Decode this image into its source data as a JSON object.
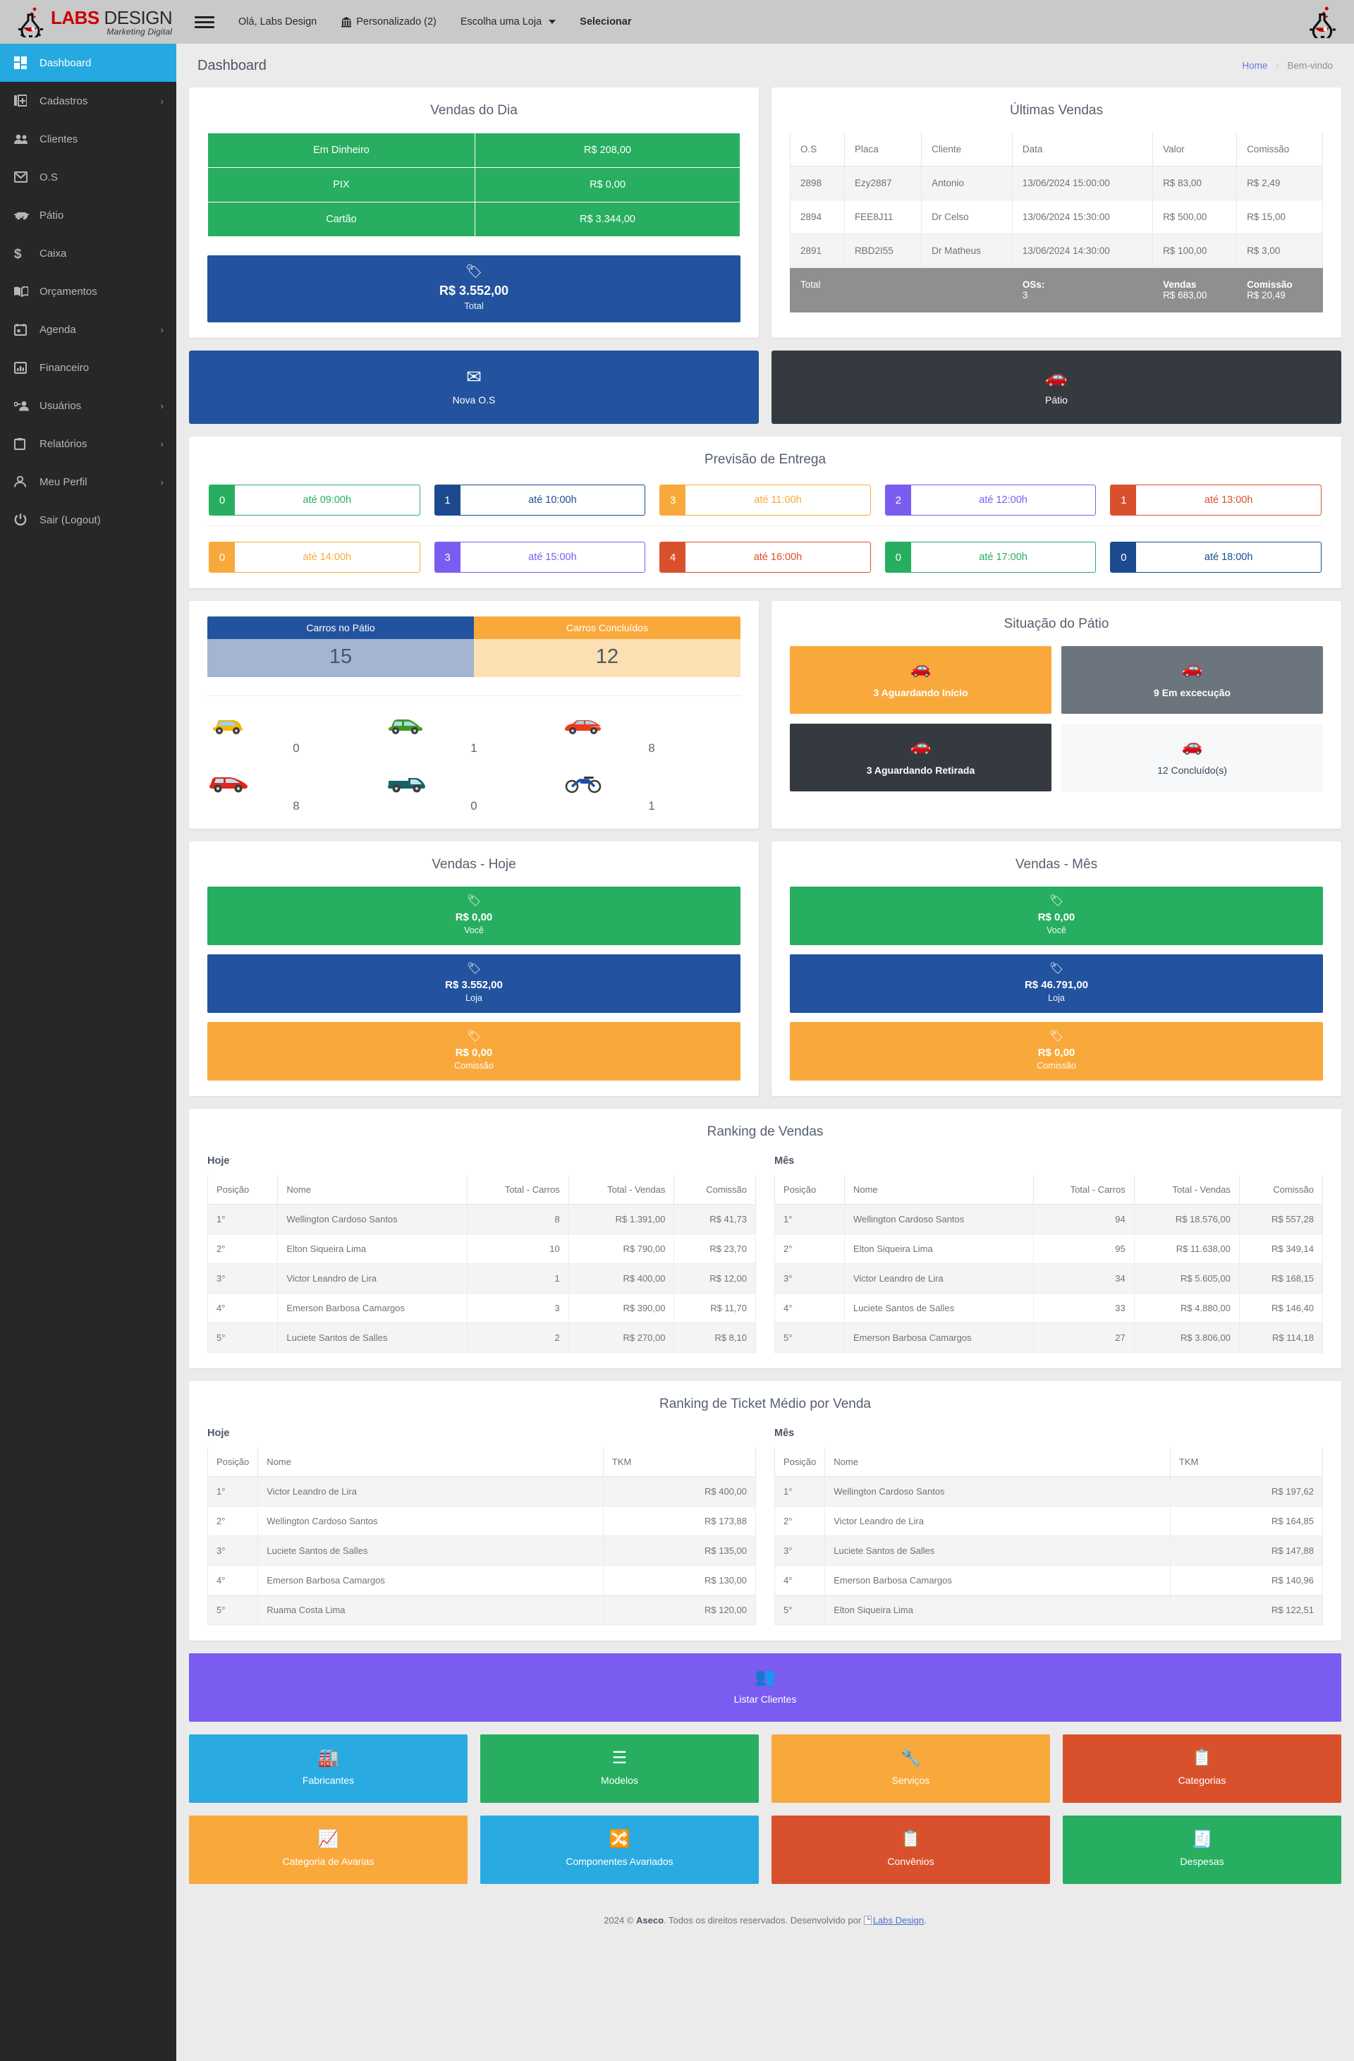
{
  "brand": {
    "line1_bold": "LABS",
    "line1_rest": " DESIGN",
    "line2": "Marketing Digital",
    "logo_icon": "flask-icon"
  },
  "topnav": {
    "menu_icon": "hamburger-icon",
    "greeting": "Olá, Labs Design",
    "custom": "Personalizado (2)",
    "store_select": "Escolha uma Loja",
    "select_button": "Selecionar",
    "avatar_icon": "flask-avatar-icon"
  },
  "sidebar": {
    "items": [
      {
        "label": "Dashboard",
        "icon": "dashboard-grid-icon",
        "active": true,
        "arrow": ""
      },
      {
        "label": "Cadastros",
        "icon": "copy-plus-icon",
        "active": false,
        "arrow": "›"
      },
      {
        "label": "Clientes",
        "icon": "users-icon",
        "active": false,
        "arrow": ""
      },
      {
        "label": "O.S",
        "icon": "envelope-icon",
        "active": false,
        "arrow": ""
      },
      {
        "label": "Pátio",
        "icon": "car-icon",
        "active": false,
        "arrow": ""
      },
      {
        "label": "Caixa",
        "icon": "dollar-icon",
        "active": false,
        "arrow": ""
      },
      {
        "label": "Orçamentos",
        "icon": "book-icon",
        "active": false,
        "arrow": ""
      },
      {
        "label": "Agenda",
        "icon": "calendar-icon",
        "active": false,
        "arrow": "›"
      },
      {
        "label": "Financeiro",
        "icon": "bar-chart-icon",
        "active": false,
        "arrow": ""
      },
      {
        "label": "Usuários",
        "icon": "user-key-icon",
        "active": false,
        "arrow": "›"
      },
      {
        "label": "Relatórios",
        "icon": "clipboard-icon",
        "active": false,
        "arrow": "›"
      },
      {
        "label": "Meu Perfil",
        "icon": "person-icon",
        "active": false,
        "arrow": "›"
      },
      {
        "label": "Sair (Logout)",
        "icon": "power-icon",
        "active": false,
        "arrow": ""
      }
    ]
  },
  "page": {
    "title": "Dashboard",
    "breadcrumb_home": "Home",
    "breadcrumb_sep": "›",
    "breadcrumb_current": "Bem-vindo"
  },
  "vendas_dia": {
    "title": "Vendas do Dia",
    "rows": [
      {
        "label": "Em Dinheiro",
        "value": "R$ 208,00"
      },
      {
        "label": "PIX",
        "value": "R$ 0,00"
      },
      {
        "label": "Cartão",
        "value": "R$ 3.344,00"
      }
    ],
    "total": {
      "icon": "tag-icon",
      "amount": "R$ 3.552,00",
      "label": "Total"
    }
  },
  "ultimas_vendas": {
    "title": "Últimas Vendas",
    "columns": [
      "O.S",
      "Placa",
      "Cliente",
      "Data",
      "Valor",
      "Comissão"
    ],
    "rows": [
      [
        "2898",
        "Ezy2887",
        "Antonio",
        "13/06/2024 15:00:00",
        "R$ 83,00",
        "R$ 2,49"
      ],
      [
        "2894",
        "FEE8J11",
        "Dr Celso",
        "13/06/2024 15:30:00",
        "R$ 500,00",
        "R$ 15,00"
      ],
      [
        "2891",
        "RBD2I55",
        "Dr Matheus",
        "13/06/2024 14:30:00",
        "R$ 100,00",
        "R$ 3,00"
      ]
    ],
    "total_row": {
      "label": "Total",
      "os_label": "OSs:",
      "os_value": "3",
      "vendas_label": "Vendas",
      "vendas_value": "R$ 683,00",
      "comissao_label": "Comissão",
      "comissao_value": "R$ 20,49"
    }
  },
  "action_buttons": [
    {
      "label": "Nova O.S",
      "icon": "envelope-icon",
      "color": "#23539e"
    },
    {
      "label": "Pátio",
      "icon": "car-icon",
      "color": "#343a40"
    }
  ],
  "previsao": {
    "title": "Previsão de Entrega",
    "slots": [
      {
        "count": "0",
        "label": "até 09:00h",
        "color": "#27ae60"
      },
      {
        "count": "1",
        "label": "até 10:00h",
        "color": "#1c4a8f"
      },
      {
        "count": "3",
        "label": "até 11:00h",
        "color": "#f9a93c"
      },
      {
        "count": "2",
        "label": "até 12:00h",
        "color": "#7a5cf0"
      },
      {
        "count": "1",
        "label": "até 13:00h",
        "color": "#d9512c"
      },
      {
        "count": "0",
        "label": "até 14:00h",
        "color": "#f9a93c"
      },
      {
        "count": "3",
        "label": "até 15:00h",
        "color": "#7a5cf0"
      },
      {
        "count": "4",
        "label": "até 16:00h",
        "color": "#d9512c"
      },
      {
        "count": "0",
        "label": "até 17:00h",
        "color": "#27ae60"
      },
      {
        "count": "0",
        "label": "até 18:00h",
        "color": "#1c4a8f"
      }
    ]
  },
  "patio_counts": {
    "left": {
      "label": "Carros no Pátio",
      "value": "15"
    },
    "right": {
      "label": "Carros Concluídos",
      "value": "12"
    },
    "vehicles": [
      {
        "icon": "small-car-yellow-icon",
        "count": "0"
      },
      {
        "icon": "hatchback-green-icon",
        "count": "1"
      },
      {
        "icon": "sedan-red-icon",
        "count": "8"
      },
      {
        "icon": "suv-red-icon",
        "count": "8"
      },
      {
        "icon": "pickup-teal-icon",
        "count": "0"
      },
      {
        "icon": "motorcycle-icon",
        "count": "1"
      }
    ]
  },
  "situacao_patio": {
    "title": "Situação do Pátio",
    "cards": [
      {
        "label": "3 Aguardando Início",
        "icon": "car-icon",
        "style": "sp-orange"
      },
      {
        "label": "9 Em excecução",
        "icon": "car-icon",
        "style": "sp-gray"
      },
      {
        "label": "3 Aguardando Retirada",
        "icon": "car-icon",
        "style": "sp-dark"
      },
      {
        "label": "12 Concluído(s)",
        "icon": "car-icon",
        "style": "sp-light"
      }
    ]
  },
  "vendas_hoje": {
    "title": "Vendas - Hoje",
    "bars": [
      {
        "amount": "R$ 0,00",
        "label": "Você",
        "style": "vb-green",
        "icon": "tag-icon"
      },
      {
        "amount": "R$ 3.552,00",
        "label": "Loja",
        "style": "vb-blue",
        "icon": "tag-icon"
      },
      {
        "amount": "R$ 0,00",
        "label": "Comissão",
        "style": "vb-orange",
        "icon": "tag-icon"
      }
    ]
  },
  "vendas_mes": {
    "title": "Vendas - Mês",
    "bars": [
      {
        "amount": "R$ 0,00",
        "label": "Você",
        "style": "vb-green",
        "icon": "tag-icon"
      },
      {
        "amount": "R$ 46.791,00",
        "label": "Loja",
        "style": "vb-blue",
        "icon": "tag-icon"
      },
      {
        "amount": "R$ 0,00",
        "label": "Comissão",
        "style": "vb-orange",
        "icon": "tag-icon"
      }
    ]
  },
  "ranking_vendas": {
    "title": "Ranking de Vendas",
    "columns": [
      "Posição",
      "Nome",
      "Total - Carros",
      "Total - Vendas",
      "Comissão"
    ],
    "hoje": {
      "sub": "Hoje",
      "rows": [
        [
          "1°",
          "Wellington Cardoso Santos",
          "8",
          "R$ 1.391,00",
          "R$ 41,73"
        ],
        [
          "2°",
          "Elton Siqueira Lima",
          "10",
          "R$ 790,00",
          "R$ 23,70"
        ],
        [
          "3°",
          "Victor Leandro de Lira",
          "1",
          "R$ 400,00",
          "R$ 12,00"
        ],
        [
          "4°",
          "Emerson Barbosa Camargos",
          "3",
          "R$ 390,00",
          "R$ 11,70"
        ],
        [
          "5°",
          "Luciete Santos de Salles",
          "2",
          "R$ 270,00",
          "R$ 8,10"
        ]
      ]
    },
    "mes": {
      "sub": "Mês",
      "rows": [
        [
          "1°",
          "Wellington Cardoso Santos",
          "94",
          "R$ 18.576,00",
          "R$ 557,28"
        ],
        [
          "2°",
          "Elton Siqueira Lima",
          "95",
          "R$ 11.638,00",
          "R$ 349,14"
        ],
        [
          "3°",
          "Victor Leandro de Lira",
          "34",
          "R$ 5.605,00",
          "R$ 168,15"
        ],
        [
          "4°",
          "Luciete Santos de Salles",
          "33",
          "R$ 4.880,00",
          "R$ 146,40"
        ],
        [
          "5°",
          "Emerson Barbosa Camargos",
          "27",
          "R$ 3.806,00",
          "R$ 114,18"
        ]
      ]
    }
  },
  "ranking_tkm": {
    "title": "Ranking de Ticket Médio por Venda",
    "columns": [
      "Posição",
      "Nome",
      "TKM"
    ],
    "hoje": {
      "sub": "Hoje",
      "rows": [
        [
          "1°",
          "Victor Leandro de Lira",
          "R$ 400,00"
        ],
        [
          "2°",
          "Wellington Cardoso Santos",
          "R$ 173,88"
        ],
        [
          "3°",
          "Luciete Santos de Salles",
          "R$ 135,00"
        ],
        [
          "4°",
          "Emerson Barbosa Camargos",
          "R$ 130,00"
        ],
        [
          "5°",
          "Ruama Costa Lima",
          "R$ 120,00"
        ]
      ]
    },
    "mes": {
      "sub": "Mês",
      "rows": [
        [
          "1°",
          "Wellington Cardoso Santos",
          "R$ 197,62"
        ],
        [
          "2°",
          "Victor Leandro de Lira",
          "R$ 164,85"
        ],
        [
          "3°",
          "Luciete Santos de Salles",
          "R$ 147,88"
        ],
        [
          "4°",
          "Emerson Barbosa Camargos",
          "R$ 140,96"
        ],
        [
          "5°",
          "Elton Siqueira Lima",
          "R$ 122,51"
        ]
      ]
    }
  },
  "listar_clientes": {
    "label": "Listar Clientes",
    "icon": "users-icon",
    "color": "#7a5cf0"
  },
  "tiles": [
    {
      "label": "Fabricantes",
      "icon": "factory-icon",
      "style": "t-sky"
    },
    {
      "label": "Modelos",
      "icon": "list-icon",
      "style": "t-green"
    },
    {
      "label": "Serviços",
      "icon": "wrench-icon",
      "style": "t-orange"
    },
    {
      "label": "Categorias",
      "icon": "layers-list-icon",
      "style": "t-red"
    },
    {
      "label": "Categoria de Avarias",
      "icon": "chart-icon",
      "style": "t-orange"
    },
    {
      "label": "Componentes Avariados",
      "icon": "shuffle-icon",
      "style": "t-sky"
    },
    {
      "label": "Convênios",
      "icon": "clipboard-icon",
      "style": "t-red"
    },
    {
      "label": "Despesas",
      "icon": "receipt-icon",
      "style": "t-green"
    }
  ],
  "footer": {
    "year_copy": "2024 ©",
    "company": "Aseco",
    "rights": ". Todos os direitos reservados. Desenvolvido por",
    "dev": "Labs Design",
    "dot": "."
  }
}
